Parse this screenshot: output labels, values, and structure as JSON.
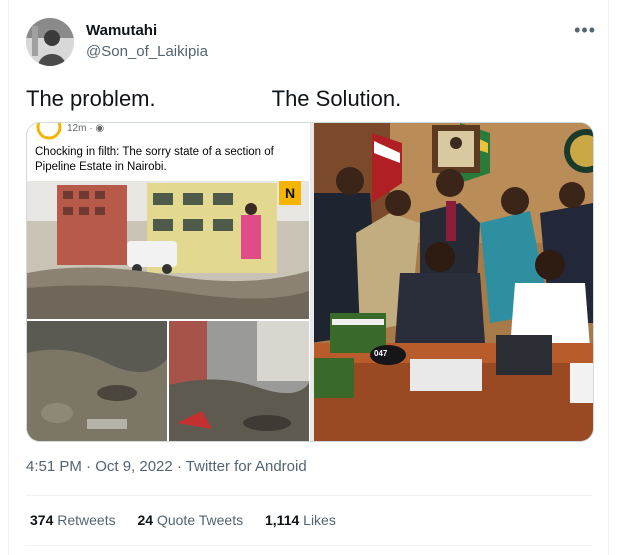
{
  "author": {
    "display_name": "Wamutahi",
    "handle": "@Son_of_Laikipia"
  },
  "more_icon": "more-horizontal-icon",
  "tweet": {
    "text_left": "The problem.",
    "text_right": "The Solution."
  },
  "media": {
    "left_post": {
      "time": "12m · ",
      "caption": "Chocking in filth: The sorry state of a section of Pipeline Estate in Nairobi.",
      "badge": "N"
    },
    "right_post": {
      "mug_label": "047"
    }
  },
  "meta": {
    "timestamp": "4:51 PM · Oct 9, 2022 · Twitter for Android"
  },
  "stats": {
    "retweets_count": "374",
    "retweets_label": "Retweets",
    "quotes_count": "24",
    "quotes_label": "Quote Tweets",
    "likes_count": "1,114",
    "likes_label": "Likes"
  },
  "colors": {
    "text_primary": "#0f1419",
    "text_secondary": "#536471",
    "border": "#cfd9de",
    "badge": "#f4b400"
  }
}
